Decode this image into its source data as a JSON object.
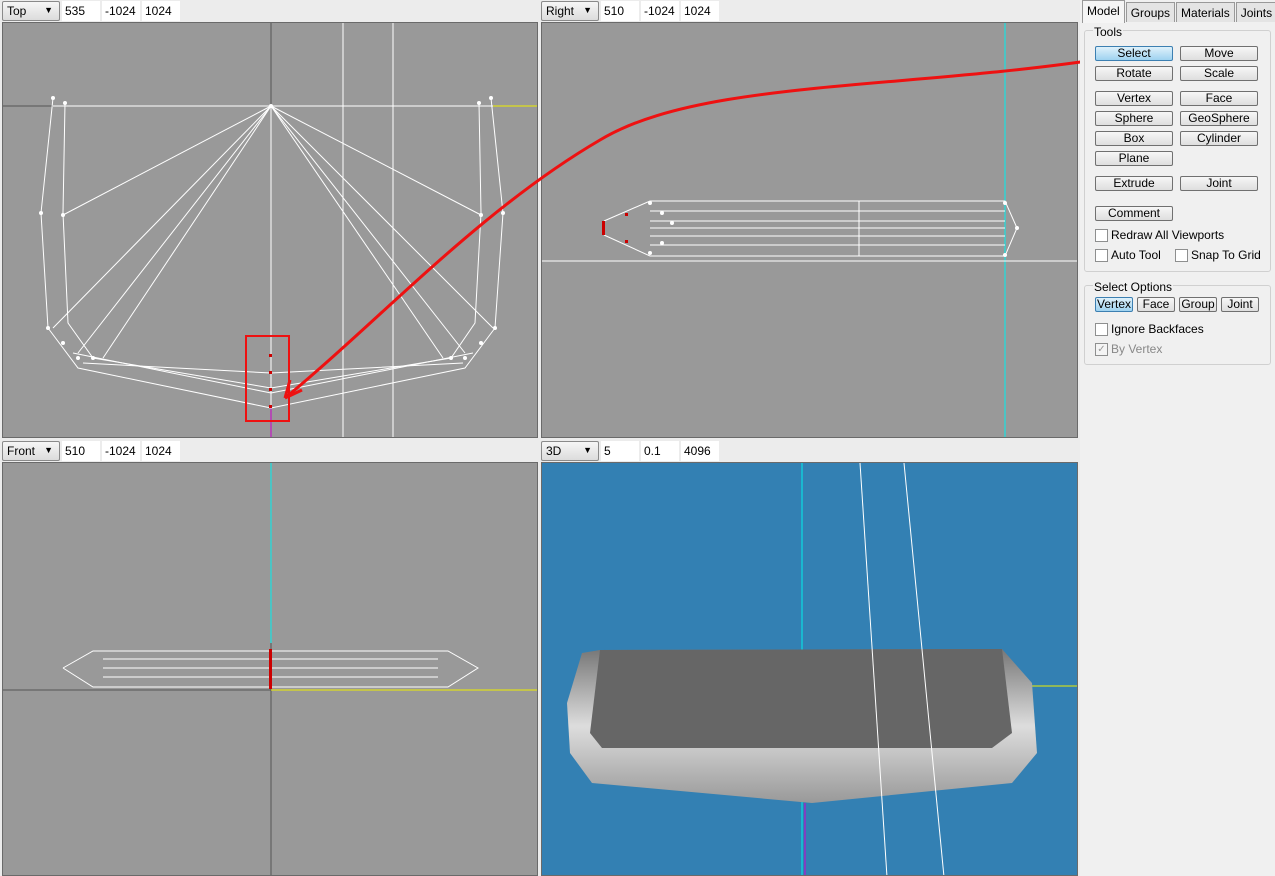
{
  "viewports": [
    {
      "view": "Top",
      "values": [
        "535",
        "-1024",
        "1024"
      ]
    },
    {
      "view": "Right",
      "values": [
        "510",
        "-1024",
        "1024"
      ]
    },
    {
      "view": "Front",
      "values": [
        "510",
        "-1024",
        "1024"
      ]
    },
    {
      "view": "3D",
      "values": [
        "5",
        "0.1",
        "4096"
      ]
    }
  ],
  "tabs": [
    "Model",
    "Groups",
    "Materials",
    "Joints"
  ],
  "active_tab": "Model",
  "tools": {
    "label": "Tools",
    "buttons": [
      "Select",
      "Move",
      "Rotate",
      "Scale",
      "Vertex",
      "Face",
      "Sphere",
      "GeoSphere",
      "Box",
      "Cylinder",
      "Plane",
      "Extrude",
      "Joint",
      "Comment"
    ],
    "active": "Select",
    "checkboxes": [
      {
        "label": "Redraw All Viewports",
        "checked": false
      },
      {
        "label": "Auto Tool",
        "checked": false
      },
      {
        "label": "Snap To Grid",
        "checked": false
      }
    ]
  },
  "select_options": {
    "label": "Select Options",
    "buttons": [
      "Vertex",
      "Face",
      "Group",
      "Joint"
    ],
    "active": "Vertex",
    "checkboxes": [
      {
        "label": "Ignore Backfaces",
        "checked": false
      },
      {
        "label": "By Vertex",
        "checked": true,
        "disabled": true
      }
    ]
  },
  "colors": {
    "viewport_bg": "#999999",
    "viewport_3d_bg": "#3380b3",
    "annotation": "#ee1111",
    "wire": "#ffffff",
    "selected_vertex": "#cc0000"
  }
}
